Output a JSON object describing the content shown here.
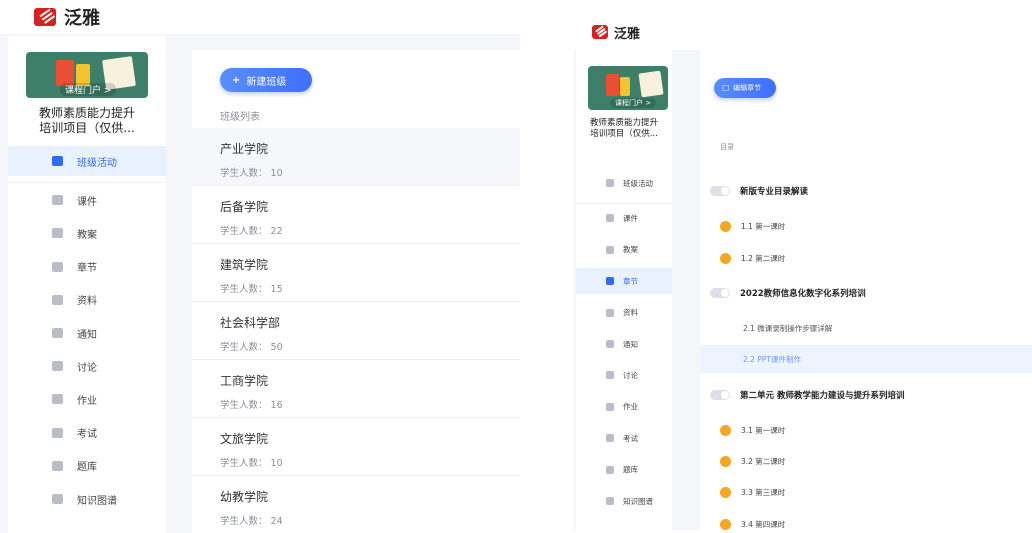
{
  "brand": {
    "name": "泛雅",
    "color": "#d9201f",
    "accent": "#2f6bff"
  },
  "course": {
    "title_line1": "教师素质能力提升",
    "title_line2": "培训项目（仅供...",
    "cover_label": "课程门户 >"
  },
  "left_screen": {
    "nav": [
      {
        "label": "班级活动",
        "icon": "grid-icon",
        "active": true
      },
      {
        "label": "课件",
        "icon": "file-icon",
        "active": false
      },
      {
        "label": "教案",
        "icon": "document-icon",
        "active": false
      },
      {
        "label": "章节",
        "icon": "list-icon",
        "active": false
      },
      {
        "label": "资料",
        "icon": "folder-icon",
        "active": false
      },
      {
        "label": "通知",
        "icon": "speaker-icon",
        "active": false
      },
      {
        "label": "讨论",
        "icon": "chat-icon",
        "active": false
      },
      {
        "label": "作业",
        "icon": "pencil-icon",
        "active": false
      },
      {
        "label": "考试",
        "icon": "exam-icon",
        "active": false
      },
      {
        "label": "题库",
        "icon": "stack-icon",
        "active": false
      },
      {
        "label": "知识图谱",
        "icon": "graph-icon",
        "active": false
      }
    ],
    "new_class_button": "新建班级",
    "class_list_label": "班级列表",
    "classes": [
      {
        "name": "产业学院",
        "count_label": "学生人数：",
        "count": "10"
      },
      {
        "name": "后备学院",
        "count_label": "学生人数：",
        "count": "22"
      },
      {
        "name": "建筑学院",
        "count_label": "学生人数：",
        "count": "15"
      },
      {
        "name": "社会科学部",
        "count_label": "学生人数：",
        "count": "50"
      },
      {
        "name": "工商学院",
        "count_label": "学生人数：",
        "count": "16"
      },
      {
        "name": "文旅学院",
        "count_label": "学生人数：",
        "count": "10"
      },
      {
        "name": "幼教学院",
        "count_label": "学生人数：",
        "count": "24"
      }
    ]
  },
  "right_screen": {
    "nav": [
      {
        "label": "班级活动",
        "icon": "grid-icon",
        "active": false
      },
      {
        "label": "课件",
        "icon": "file-icon",
        "active": false
      },
      {
        "label": "教案",
        "icon": "document-icon",
        "active": false
      },
      {
        "label": "章节",
        "icon": "list-icon",
        "active": true
      },
      {
        "label": "资料",
        "icon": "folder-icon",
        "active": false
      },
      {
        "label": "通知",
        "icon": "speaker-icon",
        "active": false
      },
      {
        "label": "讨论",
        "icon": "chat-icon",
        "active": false
      },
      {
        "label": "作业",
        "icon": "pencil-icon",
        "active": false
      },
      {
        "label": "考试",
        "icon": "exam-icon",
        "active": false
      },
      {
        "label": "题库",
        "icon": "stack-icon",
        "active": false
      },
      {
        "label": "知识图谱",
        "icon": "graph-icon",
        "active": false
      }
    ],
    "edit_chapter_button": "编辑章节",
    "toc_label": "目录",
    "chapters": [
      {
        "kind": "head",
        "label": "新版专业目录解读"
      },
      {
        "kind": "lesson",
        "label": "1.1 第一课时"
      },
      {
        "kind": "lesson",
        "label": "1.2 第二课时"
      },
      {
        "kind": "head",
        "label": "2022教师信息化数字化系列培训"
      },
      {
        "kind": "sub",
        "label": "2.1 微课录制操作步骤详解"
      },
      {
        "kind": "sub-active",
        "label": "2.2 PPT课件制作"
      },
      {
        "kind": "head",
        "label": "第二单元 教师教学能力建设与提升系列培训"
      },
      {
        "kind": "lesson",
        "label": "3.1 第一课时"
      },
      {
        "kind": "lesson",
        "label": "3.2 第二课时"
      },
      {
        "kind": "lesson",
        "label": "3.3 第三课时"
      },
      {
        "kind": "lesson",
        "label": "3.4 第四课时"
      }
    ]
  }
}
